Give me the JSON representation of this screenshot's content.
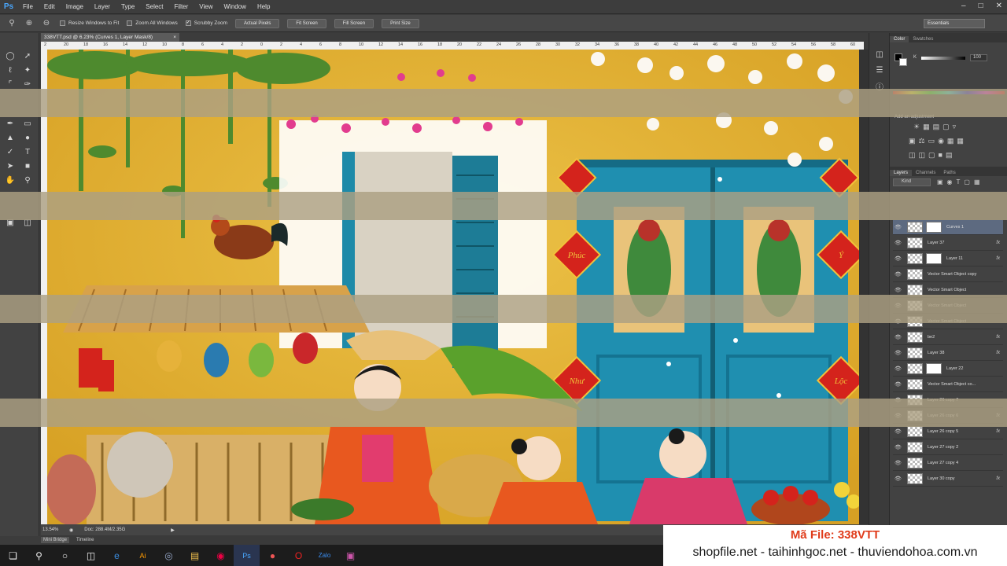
{
  "menubar": {
    "logo": "Ps",
    "items": [
      "File",
      "Edit",
      "Image",
      "Layer",
      "Type",
      "Select",
      "Filter",
      "View",
      "Window",
      "Help"
    ]
  },
  "options": {
    "resize_windows": "Resize Windows to Fit",
    "zoom_all": "Zoom All Windows",
    "scrubby_zoom": "Scrubby Zoom",
    "actual_pixels": "Actual Pixels",
    "fit_screen": "Fit Screen",
    "fill_screen": "Fill Screen",
    "print_size": "Print Size",
    "workspace": "Essentials"
  },
  "document": {
    "tab_title": "338VTT.psd @ 6.23% (Curves 1, Layer Mask/8)",
    "zoom": "13.54%",
    "doc_size": "Doc: 288.4M/2.35G"
  },
  "ruler_top": [
    "2",
    "20",
    "18",
    "16",
    "14",
    "12",
    "10",
    "8",
    "6",
    "4",
    "2",
    "0",
    "2",
    "4",
    "6",
    "8",
    "10",
    "12",
    "14",
    "16",
    "18",
    "20",
    "22",
    "24",
    "26",
    "28",
    "30",
    "32",
    "34",
    "36",
    "38",
    "40",
    "42",
    "44",
    "46",
    "48",
    "50",
    "52",
    "54",
    "56",
    "58",
    "60"
  ],
  "bottom_tabs": [
    "Mini Bridge",
    "Timeline"
  ],
  "color_panel": {
    "tabs": [
      "Color",
      "Swatches"
    ],
    "channel": "K",
    "value": "100"
  },
  "adjustments": {
    "title": "Add an adjustment"
  },
  "layers_panel": {
    "tabs": [
      "Layers",
      "Channels",
      "Paths"
    ],
    "filter": "Kind",
    "layers": [
      {
        "name": "Curves 1",
        "mask": true,
        "fx": false,
        "selected": true
      },
      {
        "name": "Layer 37",
        "mask": false,
        "fx": true,
        "selected": false
      },
      {
        "name": "Layer 11",
        "mask": true,
        "fx": true,
        "selected": false
      },
      {
        "name": "Vector Smart Object copy",
        "mask": false,
        "fx": false,
        "selected": false
      },
      {
        "name": "Vector Smart Object",
        "mask": false,
        "fx": false,
        "selected": false
      },
      {
        "name": "Vector Smart Object",
        "mask": false,
        "fx": false,
        "selected": false
      },
      {
        "name": "Vector Smart Object",
        "mask": false,
        "fx": false,
        "selected": false
      },
      {
        "name": "be2",
        "mask": false,
        "fx": true,
        "selected": false
      },
      {
        "name": "Layer 38",
        "mask": false,
        "fx": true,
        "selected": false
      },
      {
        "name": "Layer 22",
        "mask": true,
        "fx": false,
        "selected": false
      },
      {
        "name": "Vector Smart Object co...",
        "mask": false,
        "fx": false,
        "selected": false
      },
      {
        "name": "Layer 26 copy 7",
        "mask": false,
        "fx": false,
        "selected": false
      },
      {
        "name": "Layer 26 copy 6",
        "mask": false,
        "fx": true,
        "selected": false
      },
      {
        "name": "Layer 26 copy 5",
        "mask": false,
        "fx": true,
        "selected": false
      },
      {
        "name": "Layer 27 copy 2",
        "mask": false,
        "fx": false,
        "selected": false
      },
      {
        "name": "Layer 27 copy 4",
        "mask": false,
        "fx": false,
        "selected": false
      },
      {
        "name": "Layer 30 copy",
        "mask": false,
        "fx": true,
        "selected": false
      }
    ]
  },
  "canvas_text": {
    "couplet_left_top": "Phúc",
    "couplet_left_bottom": "Như",
    "couplet_right_top": "Ý",
    "couplet_right_bottom": "Lộc"
  },
  "watermark": {
    "code": "Mã File: 338VTT",
    "sites": "shopfile.net - taihinhgoc.net - thuviendohoa.com.vn"
  },
  "taskbar": {
    "apps": [
      "windows-start",
      "search",
      "cortana",
      "task-view",
      "edge",
      "illustrator",
      "globe",
      "file-explorer",
      "chrome",
      "photoshop",
      "firefox",
      "opera",
      "zalo",
      "teams"
    ]
  },
  "colors": {
    "wall_yellow": "#e8b428",
    "door_teal": "#1f8fb0",
    "couplet_red": "#d4231c",
    "selected_layer": "#5d6a80"
  }
}
